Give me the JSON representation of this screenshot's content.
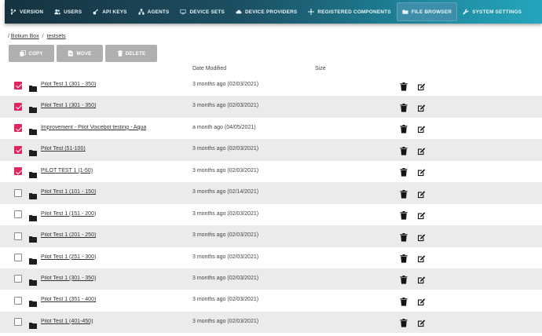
{
  "nav": [
    {
      "label": "VERSION",
      "icon": "version-icon",
      "active": false
    },
    {
      "label": "USERS",
      "icon": "users-icon",
      "active": false
    },
    {
      "label": "API KEYS",
      "icon": "key-icon",
      "active": false
    },
    {
      "label": "AGENTS",
      "icon": "agents-icon",
      "active": false
    },
    {
      "label": "DEVICE SETS",
      "icon": "device-sets-icon",
      "active": false
    },
    {
      "label": "DEVICE PROVIDERS",
      "icon": "cloud-icon",
      "active": false
    },
    {
      "label": "REGISTERED COMPONENTS",
      "icon": "components-icon",
      "active": false
    },
    {
      "label": "FILE BROWSER",
      "icon": "file-browser-icon",
      "active": true
    },
    {
      "label": "SYSTEM SETTINGS",
      "icon": "wrench-icon",
      "active": false
    }
  ],
  "breadcrumb": {
    "root": "/",
    "items": [
      "Botium Box",
      "testsets"
    ],
    "separator": "/"
  },
  "toolbar": {
    "copy_label": "COPY",
    "move_label": "MOVE",
    "delete_label": "DELETE"
  },
  "table": {
    "headers": {
      "date": "Date Modified",
      "size": "Size"
    },
    "rows": [
      {
        "checked": true,
        "name": "Pilot Test 1 (301 - 350)",
        "date": "3 months ago (02/03/2021)"
      },
      {
        "checked": true,
        "name": "Pilot Test 1 (301 - 350)",
        "date": "3 months ago (02/03/2021)"
      },
      {
        "checked": true,
        "name": "Improvement - Pilot Voicebot testing - Aqua",
        "date": "a month ago (04/05/2021)"
      },
      {
        "checked": true,
        "name": "Pilot Test (51-100)",
        "date": "3 months ago (02/03/2021)"
      },
      {
        "checked": true,
        "name": "PILOT TEST 1 (1-50)",
        "date": "3 months ago (02/03/2021)"
      },
      {
        "checked": false,
        "name": "Pilot Test 1 (101 - 150)",
        "date": "3 months ago (02/14/2021)"
      },
      {
        "checked": false,
        "name": "Pilot Test 1 (151 - 200)",
        "date": "3 months ago (02/03/2021)"
      },
      {
        "checked": false,
        "name": "Pilot Test 1 (201 - 250)",
        "date": "3 months ago (02/03/2021)"
      },
      {
        "checked": false,
        "name": "Pilot Test 1 (251 - 300)",
        "date": "3 months ago (02/03/2021)"
      },
      {
        "checked": false,
        "name": "Pilot Test 1 (301 - 350)",
        "date": "3 months ago (02/03/2021)"
      },
      {
        "checked": false,
        "name": "Pilot Test 1 (351 - 400)",
        "date": "3 months ago (02/03/2021)"
      },
      {
        "checked": false,
        "name": "Pilot Test 1 (401-450)",
        "date": "3 months ago (02/03/2021)"
      }
    ]
  },
  "colors": {
    "checkbox_checked": "#e0245e",
    "nav_active": "#3d8ea8",
    "button_gray": "#b0b0b0",
    "row_stripe": "#ebebeb"
  }
}
